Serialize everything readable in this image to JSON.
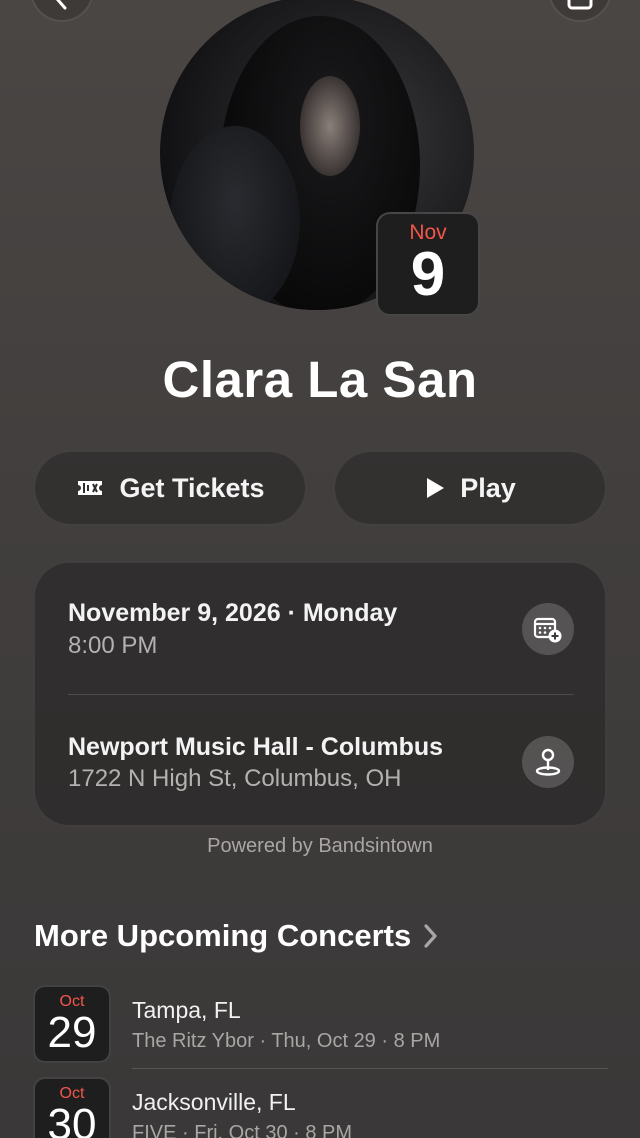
{
  "nav": {
    "back_icon": "chevron-left-icon",
    "more_icon": "share-icon"
  },
  "event": {
    "artist": "Clara La San",
    "tile_month": "Nov",
    "tile_day": "9",
    "date_line": "November 9, 2026 · Monday",
    "time": "8:00 PM",
    "venue": "Newport Music Hall - Columbus",
    "address": "1722 N High St, Columbus, OH"
  },
  "actions": {
    "tickets_label": "Get Tickets",
    "tickets_icon": "ticket-icon",
    "play_label": "Play",
    "play_icon": "play-icon",
    "add_calendar_icon": "calendar-add-icon",
    "map_icon": "map-pin-icon"
  },
  "powered_by": "Powered by Bandsintown",
  "more": {
    "title": "More Upcoming Concerts",
    "chevron_icon": "chevron-right-icon",
    "concerts": [
      {
        "month": "Oct",
        "day": "29",
        "city": "Tampa, FL",
        "detail": "The Ritz Ybor · Thu, Oct 29 · 8 PM"
      },
      {
        "month": "Oct",
        "day": "30",
        "city": "Jacksonville, FL",
        "detail": "FIVE · Fri, Oct 30 · 8 PM"
      }
    ]
  },
  "colors": {
    "accent_red": "#f2564a",
    "background": "#443f3e"
  }
}
